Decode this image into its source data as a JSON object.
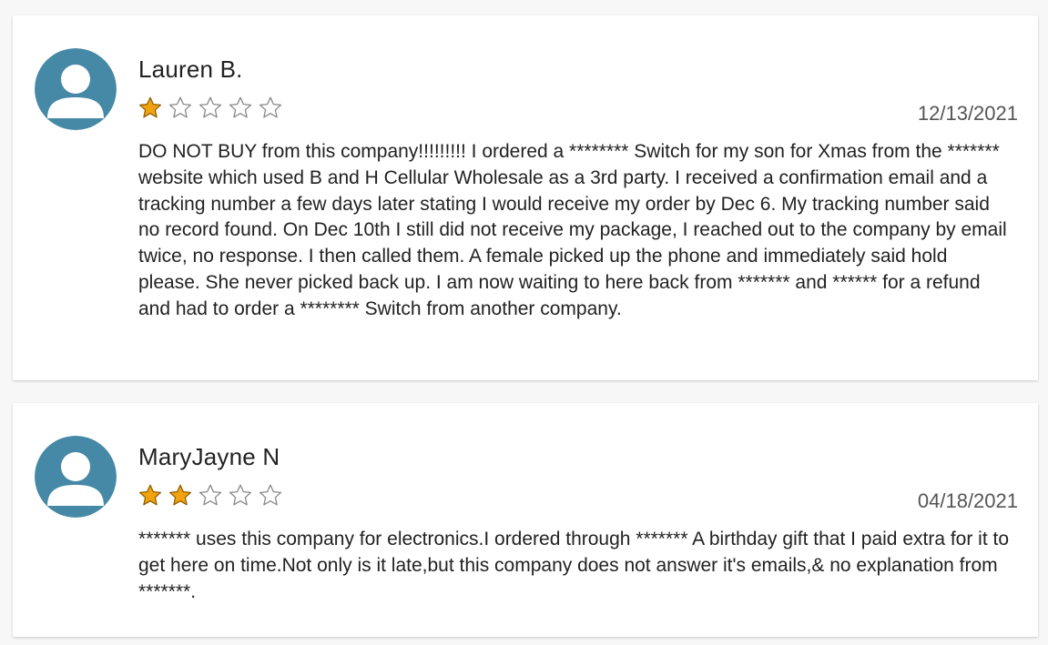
{
  "theme": {
    "avatar_color": "#4689a6",
    "star_filled_color": "#f2a20f",
    "star_empty_color": "#888888"
  },
  "reviews": [
    {
      "reviewer": "Lauren B.",
      "date": "12/13/2021",
      "rating": 1,
      "max_rating": 5,
      "text": "DO NOT BUY from this company!!!!!!!!! I ordered a ******** Switch for my son for Xmas from the ******* website which used B and H Cellular Wholesale as a 3rd party. I received a confirmation email and a tracking number a few days later stating I would receive my order by Dec 6. My tracking number said no record found. On Dec 10th I still did not receive my package, I reached out to the company by email twice, no response. I then called them. A female picked up the phone and immediately said hold please. She never picked back up. I am now waiting to here back from ******* and ****** for a refund and had to order a ******** Switch from another company."
    },
    {
      "reviewer": "MaryJayne N",
      "date": "04/18/2021",
      "rating": 2,
      "max_rating": 5,
      "text": "******* uses this company for electronics.I ordered through ******* A birthday gift that I paid extra for it to get here on time.Not only is it late,but this company does not answer it's emails,& no explanation from *******."
    }
  ]
}
